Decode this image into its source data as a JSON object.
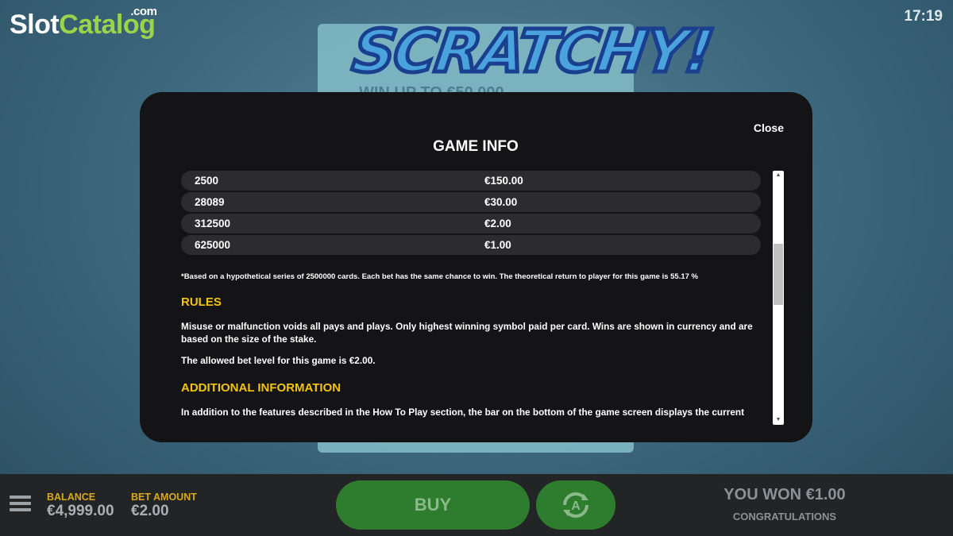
{
  "brand": {
    "part1": "Slot",
    "part2": "Catalog",
    "suffix": ".com"
  },
  "clock": "17:19",
  "background_game": {
    "logo": "SCRATCHY!",
    "subtitle": "WIN UP TO €50,000"
  },
  "modal": {
    "close_label": "Close",
    "title": "GAME INFO",
    "paytable": [
      {
        "odds": "2500",
        "prize": "€150.00"
      },
      {
        "odds": "28089",
        "prize": "€30.00"
      },
      {
        "odds": "312500",
        "prize": "€2.00"
      },
      {
        "odds": "625000",
        "prize": "€1.00"
      }
    ],
    "footnote": "*Based on a hypothetical series of 2500000 cards. Each bet has the same chance to win. The theoretical return to player for this game is 55.17 %",
    "rules_heading": "RULES",
    "rules_text_1": "Misuse or malfunction voids all pays and plays. Only highest winning symbol paid per card. Wins are shown in currency and are based on the size of the stake.",
    "rules_text_2": "The allowed bet level for this game is €2.00.",
    "additional_heading": "ADDITIONAL INFORMATION",
    "additional_text": "In addition to the features described in the How To Play section, the bar on the bottom of the game screen displays the current"
  },
  "bottom_bar": {
    "balance_label": "BALANCE",
    "balance_value": "€4,999.00",
    "bet_label": "BET AMOUNT",
    "bet_value": "€2.00",
    "buy_label": "BUY",
    "won_text": "YOU WON €1.00",
    "congrats_text": "CONGRATULATIONS"
  },
  "colors": {
    "accent_yellow": "#f2c40d",
    "button_green": "#2e7d2e",
    "modal_bg": "#141416"
  },
  "icons": {
    "menu": "hamburger-menu-icon",
    "autoplay": "autoplay-icon"
  }
}
